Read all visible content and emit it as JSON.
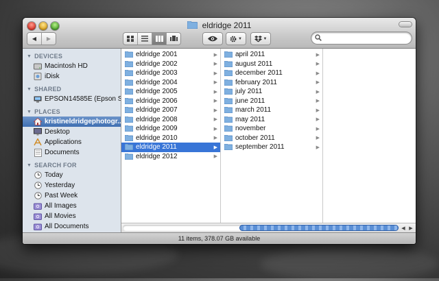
{
  "window": {
    "title": "eldridge 2011"
  },
  "toolbar": {
    "back_label": "◀",
    "forward_label": "▶",
    "search_placeholder": "",
    "search_value": ""
  },
  "sidebar": {
    "devices": {
      "header": "DEVICES",
      "items": [
        {
          "label": "Macintosh HD",
          "icon": "hard-drive-icon"
        },
        {
          "label": "iDisk",
          "icon": "idisk-icon"
        }
      ]
    },
    "shared": {
      "header": "SHARED",
      "items": [
        {
          "label": "EPSON14585E (Epson Sty...",
          "icon": "printer-icon"
        }
      ]
    },
    "places": {
      "header": "PLACES",
      "items": [
        {
          "label": "kristineldridgephotogr...",
          "icon": "home-icon",
          "selected": true
        },
        {
          "label": "Desktop",
          "icon": "desktop-icon"
        },
        {
          "label": "Applications",
          "icon": "applications-icon"
        },
        {
          "label": "Documents",
          "icon": "documents-icon"
        }
      ]
    },
    "search_for": {
      "header": "SEARCH FOR",
      "items": [
        {
          "label": "Today",
          "icon": "clock-icon"
        },
        {
          "label": "Yesterday",
          "icon": "clock-icon"
        },
        {
          "label": "Past Week",
          "icon": "clock-icon"
        },
        {
          "label": "All Images",
          "icon": "smart-folder-icon"
        },
        {
          "label": "All Movies",
          "icon": "smart-folder-icon"
        },
        {
          "label": "All Documents",
          "icon": "smart-folder-icon"
        }
      ]
    }
  },
  "columns": {
    "col1": [
      "eldridge 2001",
      "eldridge 2002",
      "eldridge 2003",
      "eldridge 2004",
      "eldridge 2005",
      "eldridge 2006",
      "eldridge 2007",
      "eldridge 2008",
      "eldridge 2009",
      "eldridge 2010",
      "eldridge 2011",
      "eldridge 2012"
    ],
    "col1_selected": "eldridge 2011",
    "col2": [
      "april 2011",
      "august 2011",
      "december 2011",
      "february 2011",
      "july 2011",
      "june 2011",
      "march 2011",
      "may 2011",
      "november",
      "october 2011",
      "september 2011"
    ]
  },
  "status": {
    "text": "11 items, 378.07 GB available"
  },
  "colors": {
    "selection": "#3875d7",
    "sidebar_bg": "#dde4ec",
    "folder": "#7fb0e0"
  }
}
